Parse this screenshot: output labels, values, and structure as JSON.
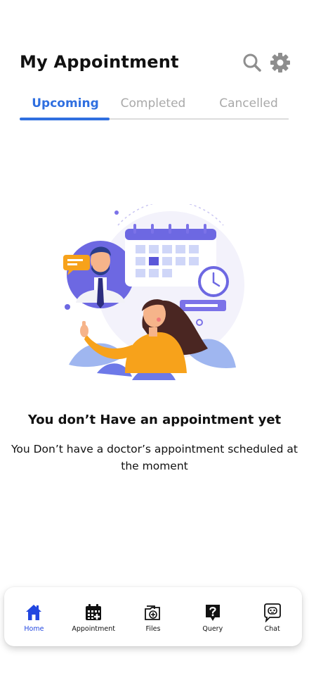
{
  "header": {
    "title": "My Appointment",
    "search_icon": "search-icon",
    "settings_icon": "gear-icon"
  },
  "tabs": [
    {
      "label": "Upcoming",
      "active": true
    },
    {
      "label": "Completed",
      "active": false
    },
    {
      "label": "Cancelled",
      "active": false
    }
  ],
  "empty_state": {
    "illustration": "doctor-appointment-illustration",
    "title": "You don’t Have an appointment yet",
    "message": "You Don’t have a doctor’s appointment scheduled at the moment"
  },
  "bottom_nav": [
    {
      "label": "Home",
      "icon": "home-icon",
      "active": true
    },
    {
      "label": "Appointment",
      "icon": "calendar-icon",
      "active": false
    },
    {
      "label": "Files",
      "icon": "files-icon",
      "active": false
    },
    {
      "label": "Query",
      "icon": "question-icon",
      "active": false
    },
    {
      "label": "Chat",
      "icon": "chat-icon",
      "active": false
    }
  ],
  "colors": {
    "accent": "#2f6fe0",
    "nav_active": "#2146e0",
    "tab_inactive": "#a9a9a9",
    "illustration_primary": "#7b72e8",
    "illustration_orange": "#f7a21b"
  }
}
